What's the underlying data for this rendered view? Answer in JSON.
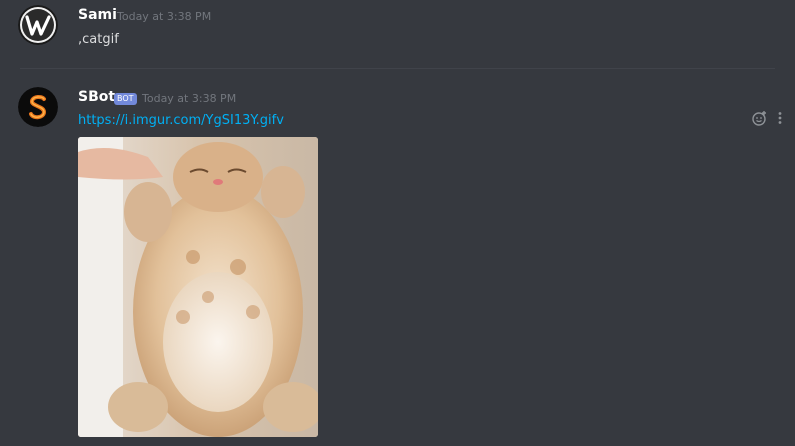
{
  "messages": [
    {
      "author": "Sami",
      "timestamp": "Today at 3:38 PM",
      "text": ",catgif",
      "avatar_icon": "wikipedia-w-logo"
    },
    {
      "author": "SBot",
      "bot_tag": "BOT",
      "timestamp": "Today at 3:38 PM",
      "link": "https://i.imgur.com/YgSI13Y.gifv",
      "embed_image": "sleeping-kitten-gif",
      "avatar_icon": "orange-s-logo"
    }
  ],
  "actions": {
    "reaction_icon": "add-reaction-icon",
    "more_icon": "more-options-icon"
  },
  "colors": {
    "background": "#36393f",
    "link": "#00b0f4",
    "bot_tag": "#7289da",
    "timestamp": "#72767d"
  }
}
